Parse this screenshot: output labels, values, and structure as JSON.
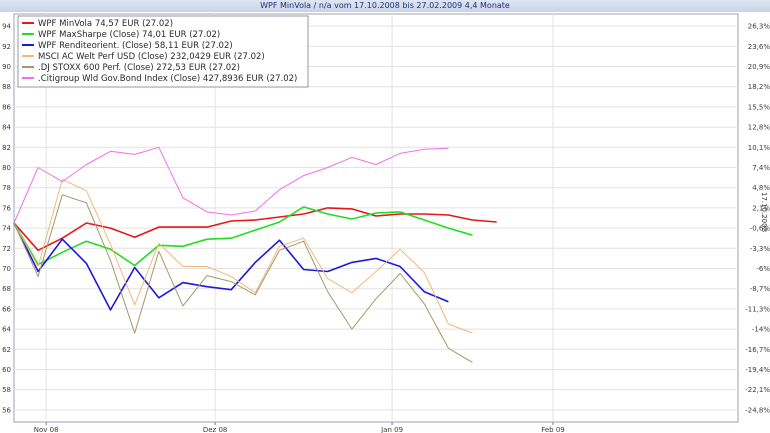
{
  "window": {
    "title": "WPF MinVola / n/a vom 17.10.2008 bis 27.02.2009 4,4 Monate"
  },
  "chart_data": {
    "type": "line",
    "title": "WPF MinVola / n/a vom 17.10.2008 bis 27.02.2009 4,4 Monate",
    "x_labels": [
      "Nov 08",
      "Dez 08",
      "Jan 09",
      "Feb 09"
    ],
    "x_label_pos": [
      4,
      25,
      47,
      67
    ],
    "x": [
      0,
      3,
      6,
      9,
      12,
      15,
      18,
      21,
      24,
      27,
      30,
      33,
      36,
      39,
      42,
      45,
      48,
      51,
      54,
      57,
      60,
      63,
      66,
      69,
      72,
      75,
      78,
      81,
      84,
      87
    ],
    "xlim": [
      0,
      90
    ],
    "ylim": [
      54.8,
      95.2
    ],
    "left_ticks": [
      94,
      92,
      90,
      88,
      86,
      84,
      82,
      80,
      78,
      76,
      74,
      72,
      70,
      68,
      66,
      64,
      62,
      60,
      58,
      56
    ],
    "right_ticks": [
      "26,3%",
      "23,6%",
      "20,9%",
      "18,2%",
      "15,5%",
      "12,8%",
      "10,1%",
      "7,4%",
      "4,8%",
      "2,1%",
      "-0,6%",
      "-3,3%",
      "-6%",
      "-8,7%",
      "-11,3%",
      "-14%",
      "-16,7%",
      "-19,4%",
      "-22,1%",
      "-24,8%"
    ],
    "right_axis_label": "17.10.2008",
    "grid": true,
    "legend_position": "top-left",
    "series": [
      {
        "name": "WPF MinVola 74,57 EUR (27.02)",
        "color": "#e41818",
        "values": [
          74.5,
          71.8,
          73.0,
          74.5,
          74.0,
          73.1,
          74.1,
          74.1,
          74.1,
          74.7,
          74.8,
          75.1,
          75.4,
          76.0,
          75.9,
          75.2,
          75.4,
          75.4,
          75.3,
          74.8,
          74.6
        ]
      },
      {
        "name": "WPF MaxSharpe (Close) 74,01 EUR (27.02)",
        "color": "#22dd22",
        "values": [
          74.5,
          70.4,
          71.6,
          72.7,
          71.9,
          70.3,
          72.3,
          72.2,
          72.9,
          73.0,
          73.8,
          74.6,
          76.1,
          75.4,
          74.9,
          75.5,
          75.6,
          74.8,
          74.0,
          73.3
        ]
      },
      {
        "name": "WPF Renditeorient. (Close) 58,11 EUR (27.02)",
        "color": "#1a1adc",
        "values": [
          74.5,
          69.7,
          72.9,
          70.5,
          65.9,
          70.1,
          67.1,
          68.6,
          68.2,
          67.9,
          70.6,
          72.8,
          69.9,
          69.7,
          70.6,
          71.0,
          70.2,
          67.7,
          66.7
        ]
      },
      {
        "name": "MSCI AC Welt Perf USD (Close) 232,0429 EUR (27.02)",
        "color": "#f4b87a",
        "values": [
          74.5,
          70.2,
          78.8,
          77.7,
          72.4,
          66.4,
          72.5,
          70.2,
          70.2,
          69.2,
          67.6,
          72.2,
          73.0,
          69.0,
          67.6,
          69.7,
          71.9,
          69.6,
          64.5,
          63.6
        ]
      },
      {
        "name": ".DJ STOXX 600 Perf. (Close) 272,53 EUR (27.02)",
        "color": "#a39a68",
        "values": [
          74.5,
          69.2,
          77.3,
          76.5,
          70.8,
          63.6,
          71.7,
          66.3,
          69.3,
          68.7,
          67.4,
          71.8,
          72.7,
          67.7,
          64.0,
          67.0,
          69.5,
          66.5,
          62.1,
          60.7
        ]
      },
      {
        "name": ".Citigroup Wld Gov.Bond Index (Close) 427,8936 EUR (27.02)",
        "color": "#ef6ef0",
        "values": [
          74.5,
          80.0,
          78.6,
          80.3,
          81.6,
          81.3,
          82.0,
          77.0,
          75.6,
          75.3,
          75.7,
          77.8,
          79.2,
          80.0,
          81.0,
          80.3,
          81.4,
          81.8,
          81.9
        ]
      }
    ]
  }
}
